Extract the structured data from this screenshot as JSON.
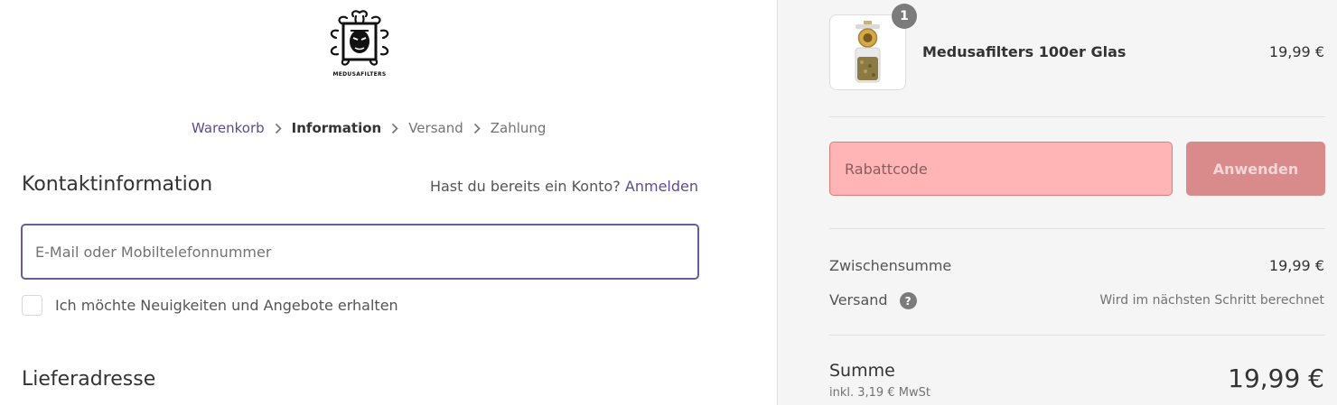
{
  "brand": {
    "name": "MEDUSAFILTERS"
  },
  "breadcrumb": {
    "items": [
      "Warenkorb",
      "Information",
      "Versand",
      "Zahlung"
    ]
  },
  "contact": {
    "title": "Kontaktinformation",
    "login_prompt": "Hast du bereits ein Konto?",
    "login_link": "Anmelden",
    "email_placeholder": "E-Mail oder Mobiltelefonnummer",
    "newsletter_label": "Ich möchte Neuigkeiten und Angebote erhalten",
    "newsletter_checked": false
  },
  "shipping_address": {
    "title": "Lieferadresse"
  },
  "summary": {
    "product": {
      "name": "Medusafilters 100er Glas",
      "price": "19,99 €",
      "quantity": "1"
    },
    "discount": {
      "placeholder": "Rabattcode",
      "button": "Anwenden"
    },
    "subtotal_label": "Zwischensumme",
    "subtotal_value": "19,99 €",
    "shipping_label": "Versand",
    "shipping_hint": "Wird im nächsten Schritt berechnet",
    "help_symbol": "?",
    "total_label": "Summe",
    "total_tax": "inkl. 3,19 € MwSt",
    "total_value": "19,99 €"
  },
  "colors": {
    "accent": "#5c4b8f",
    "discount_bg": "#ffb5b5",
    "apply_bg": "#d98a8a"
  },
  "icons": {
    "breadcrumb_separator": "chevron-right-icon",
    "shipping_help": "question-circle-icon"
  }
}
